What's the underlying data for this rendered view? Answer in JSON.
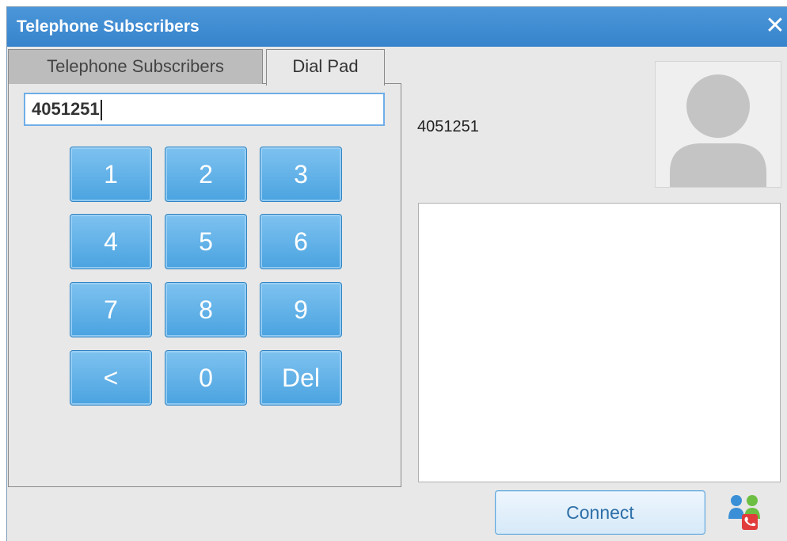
{
  "window": {
    "title": "Telephone Subscribers",
    "close_glyph": "✕"
  },
  "tabs": [
    {
      "label": "Telephone Subscribers",
      "active": false
    },
    {
      "label": "Dial Pad",
      "active": true
    }
  ],
  "dialpad": {
    "input_value": "4051251",
    "keys": [
      "1",
      "2",
      "3",
      "4",
      "5",
      "6",
      "7",
      "8",
      "9",
      "<",
      "0",
      "Del"
    ]
  },
  "contact": {
    "number": "4051251",
    "avatar_icon": "person-placeholder-icon"
  },
  "actions": {
    "connect_label": "Connect",
    "contacts_icon": "contacts-call-icon"
  },
  "colors": {
    "titlebar": "#3f8cd2",
    "key_fill": "#5fb0e8",
    "connect_text": "#2e6fa8"
  }
}
